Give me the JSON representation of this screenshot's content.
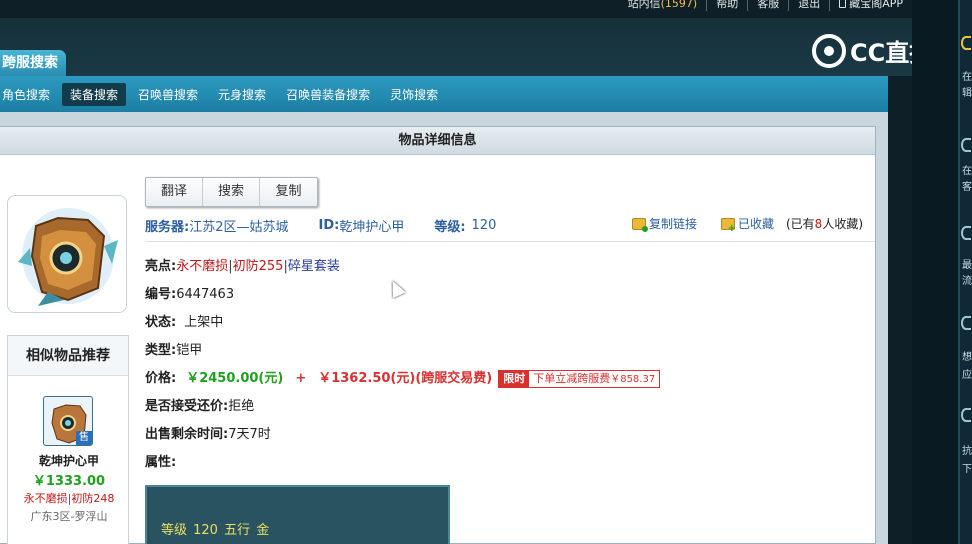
{
  "topbar": {
    "links": [
      {
        "label": "站内信",
        "count": "(1597)"
      },
      {
        "label": "帮助"
      },
      {
        "label": "客服"
      },
      {
        "label": "退出"
      },
      {
        "label": "藏宝阁APP"
      }
    ]
  },
  "header": {
    "title_tab": "跨服搜索",
    "cc_logo": "CC直播"
  },
  "nav": {
    "items": [
      {
        "label": "角色搜索"
      },
      {
        "label": "装备搜索",
        "active": true
      },
      {
        "label": "召唤兽搜索"
      },
      {
        "label": "元身搜索"
      },
      {
        "label": "召唤兽装备搜索"
      },
      {
        "label": "灵饰搜索"
      }
    ]
  },
  "panel": {
    "title": "物品详细信息",
    "buttons": [
      "翻译",
      "搜索",
      "复制"
    ],
    "meta": {
      "server_label": "服务器:",
      "server_value": "江苏2区—姑苏城",
      "id_label": "ID:",
      "id_value": "乾坤护心甲",
      "level_label": "等级:",
      "level_value": "120"
    },
    "actions": {
      "copy_link": "复制链接",
      "favorited": "已收藏",
      "fav_prefix": "(已有",
      "fav_count": "8",
      "fav_suffix": "人收藏)"
    },
    "rows": {
      "highlight_label": "亮点:",
      "highlight_1": "永不磨损",
      "highlight_2": "初防255",
      "highlight_3": "碎星套装",
      "sep": "|",
      "number_label": "编号:",
      "number_value": "6447463",
      "status_label": "状态:",
      "status_value": "上架中",
      "type_label": "类型:",
      "type_value": "铠甲",
      "price_label": "价格:",
      "price_main": "￥2450.00(元)",
      "price_plus": "+",
      "price_fee": "￥1362.50(元)(跨服交易费)",
      "limit_tag": "限时",
      "limit_text": "下单立减跨服费",
      "limit_amount": "￥858.37",
      "counter_label": "是否接受还价:",
      "counter_value": "拒绝",
      "remain_label": "出售剩余时间:",
      "remain_value": "7天7时",
      "attr_label": "属性:"
    },
    "attr_box": {
      "line": "等级 120 五行 金"
    }
  },
  "recommend": {
    "title": "相似物品推荐",
    "sell_badge": "售",
    "name": "乾坤护心甲",
    "price": "￥1333.00",
    "tag_1": "永不磨损",
    "tag_sep": "|",
    "tag_2": "初防248",
    "server": "广东3区-罗浮山"
  },
  "side": {
    "texts": [
      "在",
      "辑",
      "在",
      "客",
      "最",
      "流",
      "想",
      "应",
      "抗",
      "下"
    ]
  }
}
